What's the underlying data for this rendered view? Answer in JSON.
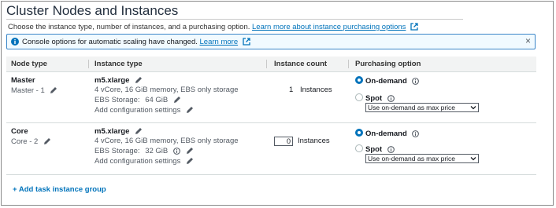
{
  "section": {
    "title": "Cluster Nodes and Instances",
    "subtitle_text": "Choose the instance type, number of instances, and a purchasing option.",
    "subtitle_link": "Learn more about instance purchasing options"
  },
  "alert": {
    "message": "Console options for automatic scaling have changed.",
    "link": "Learn more",
    "close": "×"
  },
  "table": {
    "headers": {
      "node_type": "Node type",
      "instance_type": "Instance type",
      "instance_count": "Instance count",
      "purchasing_option": "Purchasing option"
    },
    "rows": [
      {
        "node_type": "Master",
        "node_name": "Master - 1",
        "instance_type": "m5.xlarge",
        "specs": "4 vCore, 16 GiB memory, EBS only storage",
        "ebs_label": "EBS Storage:",
        "ebs_value": "64 GiB",
        "config_link": "Add configuration settings",
        "count": "1",
        "count_unit": "Instances",
        "on_demand_label": "On-demand",
        "spot_label": "Spot",
        "spot_select": "Use on-demand as max price",
        "selected": "on-demand"
      },
      {
        "node_type": "Core",
        "node_name": "Core - 2",
        "instance_type": "m5.xlarge",
        "specs": "4 vCore, 16 GiB memory, EBS only storage",
        "ebs_label": "EBS Storage:",
        "ebs_value": "32 GiB",
        "config_link": "Add configuration settings",
        "count": "0",
        "count_unit": "Instances",
        "on_demand_label": "On-demand",
        "spot_label": "Spot",
        "spot_select": "Use on-demand as max price",
        "selected": "on-demand"
      }
    ]
  },
  "actions": {
    "add_task_group": "+ Add task instance group"
  },
  "icons": {
    "external_link": "external-link-icon",
    "info": "info-icon",
    "pencil": "pencil-icon",
    "close": "close-icon",
    "chevron": "chevron-down-icon"
  },
  "colors": {
    "link": "#0073bb",
    "alert_border": "#3a86c8",
    "alert_bg": "#f1faff",
    "header_bg": "#f2f3f3"
  }
}
